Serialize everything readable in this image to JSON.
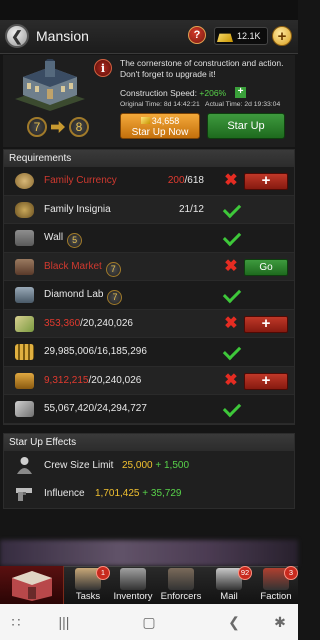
{
  "header": {
    "title": "Mansion",
    "gold": "12.1K"
  },
  "building": {
    "level_from": "7",
    "level_to": "8",
    "description": "The cornerstone of construction and action. Don't forget to upgrade it!",
    "speed_label": "Construction Speed:",
    "speed_value": "+206%",
    "original_time": "Original Time: 8d 14:42:21",
    "actual_time": "Actual Time: 2d 19:33:04",
    "star_up_now_cost": "34,658",
    "star_up_now_label": "Star Up Now",
    "star_up_label": "Star Up"
  },
  "requirements": {
    "title": "Requirements",
    "rows": [
      {
        "name": "Family Currency",
        "have": "200",
        "need": "/618",
        "met": false,
        "action": "+",
        "icon": "coin-icon",
        "name_red": true
      },
      {
        "name": "Family Insignia",
        "have": "21",
        "need": "/12",
        "met": true,
        "icon": "insignia-icon",
        "name_red": false
      },
      {
        "name": "Wall",
        "level": "5",
        "met": true,
        "icon": "wall-icon",
        "name_red": false
      },
      {
        "name": "Black Market",
        "level": "7",
        "met": false,
        "action": "Go",
        "icon": "black-market-icon",
        "name_red": true
      },
      {
        "name": "Diamond Lab",
        "level": "7",
        "met": true,
        "icon": "diamond-lab-icon",
        "name_red": false
      },
      {
        "have": "353,360",
        "need": "/20,240,026",
        "met": false,
        "action": "+",
        "icon": "cash-icon"
      },
      {
        "have": "29,985,006",
        "need": "/16,185,296",
        "met": true,
        "icon": "ammo-icon"
      },
      {
        "have": "9,312,215",
        "need": "/20,240,026",
        "met": false,
        "action": "+",
        "icon": "cargo-icon"
      },
      {
        "have": "55,067,420",
        "need": "/24,294,727",
        "met": true,
        "icon": "metal-icon"
      }
    ]
  },
  "effects": {
    "title": "Star Up Effects",
    "rows": [
      {
        "name": "Crew Size Limit",
        "value": "25,000",
        "add": "+ 1,500",
        "icon": "crew-icon"
      },
      {
        "name": "Influence",
        "value": "1,701,425",
        "add": "+ 35,729",
        "icon": "pistol-icon"
      }
    ]
  },
  "nav": {
    "items": [
      {
        "label": "Tasks",
        "badge": "1"
      },
      {
        "label": "Inventory",
        "badge": ""
      },
      {
        "label": "Enforcers",
        "badge": ""
      },
      {
        "label": "Mail",
        "badge": "92"
      },
      {
        "label": "Faction",
        "badge": "3"
      }
    ]
  },
  "colors": {
    "gold": "#f0c030",
    "green": "#3ec83a",
    "red": "#e03a2f",
    "orange_button": "#e08a20",
    "green_button": "#2e822e"
  }
}
